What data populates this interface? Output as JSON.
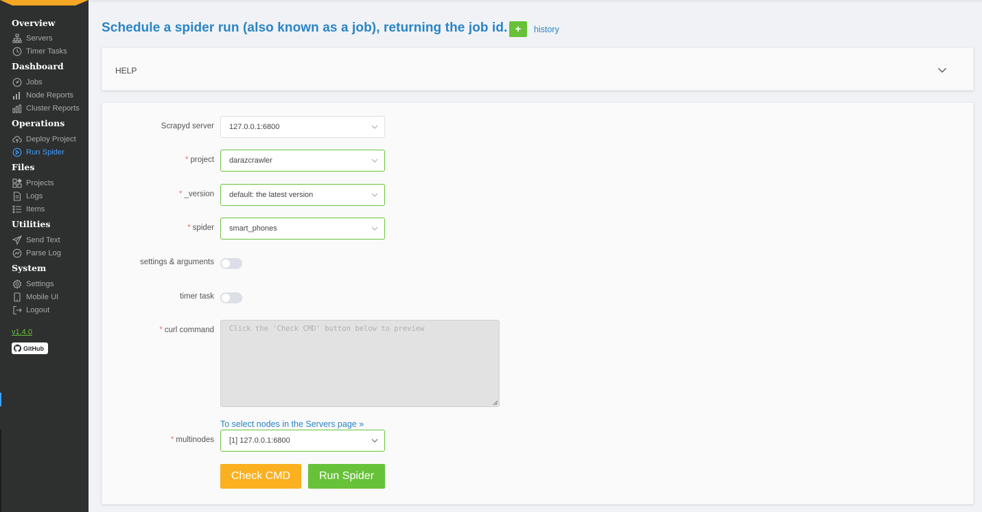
{
  "sidebar": {
    "sections": {
      "overview": "Overview",
      "dashboard": "Dashboard",
      "operations": "Operations",
      "files": "Files",
      "utilities": "Utilities",
      "system": "System"
    },
    "items": {
      "servers": "Servers",
      "timer_tasks": "Timer Tasks",
      "jobs": "Jobs",
      "node_reports": "Node Reports",
      "cluster_reports": "Cluster Reports",
      "deploy_project": "Deploy Project",
      "run_spider": "Run Spider",
      "projects": "Projects",
      "logs": "Logs",
      "items": "Items",
      "send_text": "Send Text",
      "parse_log": "Parse Log",
      "settings": "Settings",
      "mobile_ui": "Mobile UI",
      "logout": "Logout"
    },
    "active_item": "Run Spider",
    "version": "v1.4.0",
    "github_label": "GitHub"
  },
  "header": {
    "title": "Schedule a spider run (also known as a job), returning the job id.",
    "plus_label": "+",
    "history_label": "history"
  },
  "help": {
    "label": "HELP",
    "expanded": false
  },
  "form": {
    "server": {
      "label": "Scrapyd server",
      "value": "127.0.0.1:6800"
    },
    "project": {
      "label": "project",
      "value": "darazcrawler"
    },
    "version": {
      "label": "_version",
      "value": "default: the latest version"
    },
    "spider": {
      "label": "spider",
      "value": "smart_phones"
    },
    "settings_args": {
      "label": "settings & arguments",
      "on": false
    },
    "timer_task": {
      "label": "timer task",
      "on": false
    },
    "curl": {
      "label": "curl command",
      "placeholder": "Click the 'Check CMD' button below to preview"
    },
    "servers_link": "To select nodes in the Servers page »",
    "multinodes": {
      "label": "multinodes",
      "value": "[1] 127.0.0.1:6800"
    },
    "required_mark": "*",
    "check_cmd_label": "Check CMD",
    "run_spider_label": "Run Spider"
  },
  "colors": {
    "sidebar_bg": "#2e2f2f",
    "accent_blue": "#2a84c5",
    "active_blue": "#409eff",
    "success_green": "#67c23a",
    "warning_orange": "#fbb020",
    "required_red": "#f56c6c"
  },
  "icons": {
    "servers": "sitemap-icon",
    "timer_tasks": "clock-icon",
    "jobs": "speedometer-icon",
    "node_reports": "bar-chart-icon",
    "cluster_reports": "bar-chart-icon",
    "deploy_project": "cloud-upload-icon",
    "run_spider": "play-circle-icon",
    "projects": "grid-icon",
    "logs": "document-icon",
    "items": "list-icon",
    "send_text": "paper-plane-icon",
    "parse_log": "line-chart-icon",
    "settings": "gear-icon",
    "mobile_ui": "mobile-icon",
    "logout": "logout-icon",
    "github": "github-icon"
  }
}
